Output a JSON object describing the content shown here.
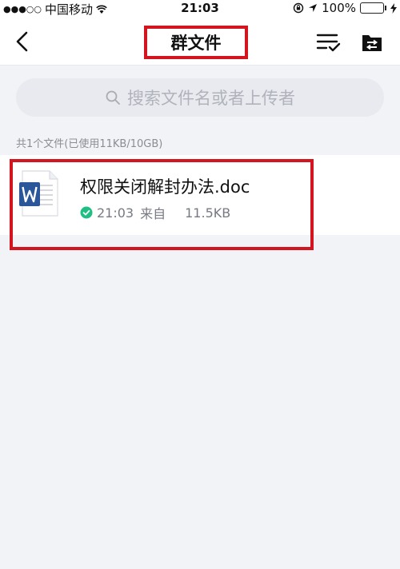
{
  "status_bar": {
    "carrier": "中国移动",
    "time": "21:03",
    "battery": "100%"
  },
  "nav": {
    "title": "群文件"
  },
  "search": {
    "placeholder": "搜索文件名或者上传者"
  },
  "summary": "共1个文件(已使用11KB/10GB)",
  "files": [
    {
      "name": "权限关闭解封办法.doc",
      "time": "21:03",
      "from": "来自",
      "size": "11.5KB",
      "icon": "word-doc-icon"
    }
  ],
  "colors": {
    "highlight": "#d2151e",
    "word_blue": "#2b579a",
    "check_green": "#1fbf84",
    "background": "#f2f3f6"
  }
}
